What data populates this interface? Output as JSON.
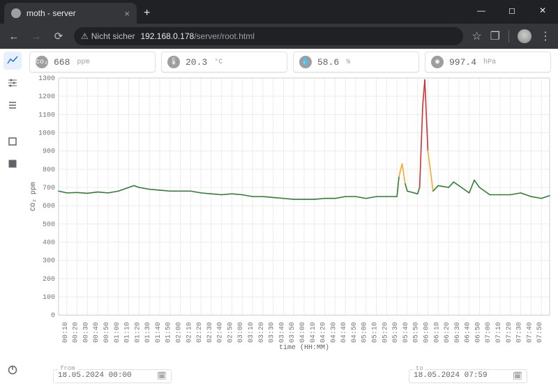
{
  "browser": {
    "tab_title": "moth - server",
    "insecure_label": "Nicht sicher",
    "url_host": "192.168.0.178",
    "url_path": "/server/root.html"
  },
  "metrics": {
    "co2": {
      "value": "668",
      "unit": "ppm"
    },
    "temp": {
      "value": "20.3",
      "unit": "°C"
    },
    "humidity": {
      "value": "58.6",
      "unit": "%"
    },
    "pressure": {
      "value": "997.4",
      "unit": "hPa"
    }
  },
  "chart": {
    "xlabel": "time (HH:MM)",
    "ylabel": "CO₂ ppm"
  },
  "range": {
    "from_label": "from",
    "from_value": "18.05.2024 00:00",
    "to_label": "to",
    "to_value": "18.05.2024 07:59"
  },
  "chart_data": {
    "type": "line",
    "xlabel": "time (HH:MM)",
    "ylabel": "CO₂ ppm",
    "ylim": [
      0,
      1300
    ],
    "x_ticks": [
      "00:10",
      "00:20",
      "00:30",
      "00:40",
      "00:50",
      "01:00",
      "01:10",
      "01:20",
      "01:30",
      "01:40",
      "01:50",
      "02:00",
      "02:10",
      "02:20",
      "02:30",
      "02:40",
      "02:50",
      "03:00",
      "03:10",
      "03:20",
      "03:30",
      "03:40",
      "03:50",
      "04:00",
      "04:10",
      "04:20",
      "04:30",
      "04:40",
      "04:50",
      "05:00",
      "05:10",
      "05:20",
      "05:30",
      "05:40",
      "05:50",
      "06:00",
      "06:10",
      "06:20",
      "06:30",
      "06:40",
      "06:50",
      "07:00",
      "07:10",
      "07:20",
      "07:30",
      "07:40",
      "07:50"
    ],
    "series": [
      {
        "name": "CO₂ ppm",
        "x_minutes": [
          2,
          10,
          20,
          30,
          40,
          50,
          60,
          70,
          75,
          80,
          90,
          100,
          110,
          120,
          130,
          140,
          150,
          160,
          170,
          180,
          190,
          200,
          210,
          220,
          230,
          240,
          250,
          260,
          270,
          280,
          290,
          300,
          310,
          320,
          330,
          332,
          335,
          338,
          340,
          350,
          352,
          355,
          357,
          360,
          365,
          370,
          380,
          385,
          390,
          400,
          405,
          410,
          420,
          430,
          440,
          450,
          460,
          470,
          478
        ],
        "values": [
          680,
          670,
          672,
          668,
          675,
          670,
          680,
          700,
          710,
          700,
          690,
          685,
          680,
          680,
          680,
          670,
          665,
          660,
          665,
          660,
          650,
          650,
          645,
          640,
          635,
          635,
          635,
          640,
          640,
          650,
          650,
          640,
          650,
          650,
          650,
          760,
          830,
          720,
          680,
          665,
          700,
          1150,
          1290,
          900,
          680,
          710,
          700,
          730,
          710,
          670,
          740,
          700,
          660,
          660,
          660,
          670,
          650,
          640,
          655
        ],
        "color_scale": {
          "low": "#2e7d32",
          "mid": "#f9a825",
          "high": "#d32f2f",
          "mid_threshold": 800,
          "high_threshold": 1000
        }
      }
    ]
  }
}
